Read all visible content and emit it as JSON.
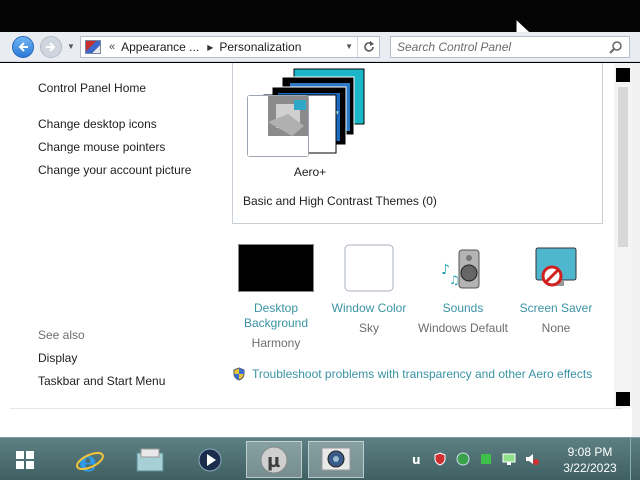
{
  "window": {
    "nav": {
      "back_icon": "back-arrow-icon",
      "forward_icon": "forward-arrow-icon"
    },
    "address": {
      "overflow": "«",
      "breadcrumbs": [
        "Appearance ...",
        "Personalization"
      ]
    },
    "search": {
      "placeholder": "Search Control Panel"
    }
  },
  "left_pane": {
    "home": "Control Panel Home",
    "links": [
      "Change desktop icons",
      "Change mouse pointers",
      "Change your account picture"
    ],
    "see_also_label": "See also",
    "see_also": [
      "Display",
      "Taskbar and Start Menu"
    ]
  },
  "themes": {
    "selected_theme": "Aero+",
    "basic_section": "Basic and High Contrast Themes (0)"
  },
  "tiles": [
    {
      "title_line1": "Desktop",
      "title_line2": "Background",
      "value": "Harmony",
      "icon": "desktop-background-icon"
    },
    {
      "title_line1": "Window Color",
      "title_line2": "",
      "value": "Sky",
      "icon": "window-color-icon"
    },
    {
      "title_line1": "Sounds",
      "title_line2": "",
      "value": "Windows Default",
      "icon": "sounds-icon"
    },
    {
      "title_line1": "Screen Saver",
      "title_line2": "",
      "value": "None",
      "icon": "screen-saver-icon"
    }
  ],
  "troubleshoot": {
    "label": "Troubleshoot problems with transparency and other Aero effects",
    "icon": "shield-icon"
  },
  "taskbar": {
    "start_icon": "windows-start-icon",
    "pinned": [
      "internet-explorer-icon",
      "file-explorer-icon",
      "media-player-icon",
      "utorrent-icon",
      "control-panel-icon"
    ],
    "tray_icons": [
      "utorrent-tray-icon",
      "security-shield-icon",
      "network-globe-icon",
      "green-app-icon",
      "display-monitor-icon",
      "volume-muted-icon"
    ],
    "time": "9:08 PM",
    "date": "3/22/2023"
  },
  "colors": {
    "link_teal": "#3a93a5",
    "taskbar": "#4d7073",
    "nav_blue": "#2a7ad8"
  }
}
